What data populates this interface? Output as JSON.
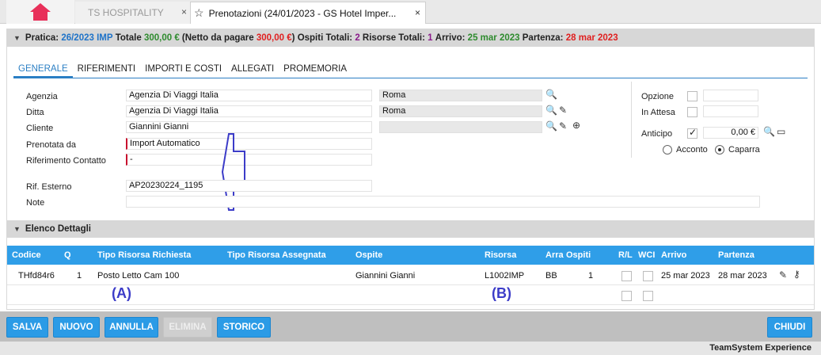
{
  "tabs": {
    "home_icon": "home-icon",
    "ts_label": "TS HOSPITALITY",
    "active_label": "Prenotazioni (24/01/2023 - GS Hotel Imper...",
    "close_glyph": "×"
  },
  "summary": {
    "pratica_label": "Pratica:",
    "pratica_value": "26/2023 IMP",
    "totale_label": "Totale",
    "totale_value": "300,00 €",
    "netto_open": "(Netto da pagare",
    "netto_value": "300,00 €",
    "netto_close": ")",
    "ospiti_label": "Ospiti Totali:",
    "ospiti_value": "2",
    "risorse_label": "Risorse Totali:",
    "risorse_value": "1",
    "arrivo_label": "Arrivo:",
    "arrivo_value": "25 mar 2023",
    "partenza_label": "Partenza:",
    "partenza_value": "28 mar 2023"
  },
  "subtabs": [
    "GENERALE",
    "RIFERIMENTI",
    "IMPORTI E COSTI",
    "ALLEGATI",
    "PROMEMORIA"
  ],
  "form": {
    "agenzia_label": "Agenzia",
    "agenzia_value": "Agenzia Di Viaggi Italia",
    "agenzia_city": "Roma",
    "ditta_label": "Ditta",
    "ditta_value": "Agenzia Di Viaggi Italia",
    "ditta_city": "Roma",
    "cliente_label": "Cliente",
    "cliente_value": "Giannini Gianni",
    "cliente_city": "",
    "prenotata_label": "Prenotata da",
    "prenotata_value": "Import Automatico",
    "riferimento_label": "Riferimento Contatto",
    "riferimento_value": "-",
    "rif_esterno_label": "Rif. Esterno",
    "rif_esterno_value": "AP20230224_1195",
    "note_label": "Note",
    "note_value": ""
  },
  "options": {
    "opzione_label": "Opzione",
    "opzione_value": "",
    "attesa_label": "In Attesa",
    "attesa_value": "",
    "anticipo_label": "Anticipo",
    "anticipo_value": "0,00 €",
    "acconto_label": "Acconto",
    "caparra_label": "Caparra"
  },
  "details": {
    "title": "Elenco Dettagli",
    "columns": {
      "codice": "Codice",
      "q": "Q",
      "tipo_richiesta": "Tipo Risorsa Richiesta",
      "tipo_assegnata": "Tipo Risorsa Assegnata",
      "ospite": "Ospite",
      "risorsa": "Risorsa",
      "arra": "Arra",
      "ospiti": "Ospiti",
      "rl": "R/L",
      "wci": "WCI",
      "arrivo": "Arrivo",
      "partenza": "Partenza"
    },
    "rows": [
      {
        "codice": "THfd84r6",
        "q": "1",
        "tipo_richiesta": "Posto Letto Cam 100",
        "tipo_assegnata": "",
        "ospite": "Giannini Gianni",
        "risorsa": "L1002IMP",
        "arra": "BB",
        "ospiti": "1",
        "arrivo": "25 mar 2023",
        "partenza": "28 mar 2023"
      }
    ],
    "annotation_a": "(A)",
    "annotation_b": "(B)"
  },
  "toolbar": {
    "salva": "SALVA",
    "nuovo": "NUOVO",
    "annulla": "ANNULLA",
    "elimina": "ELIMINA",
    "storico": "STORICO",
    "chiudi": "CHIUDI"
  },
  "footer": {
    "brand": "TeamSystem Experience"
  },
  "colors": {
    "accent": "#2f9ee8",
    "home": "#e8305a",
    "annotation": "#3c3cc8"
  }
}
